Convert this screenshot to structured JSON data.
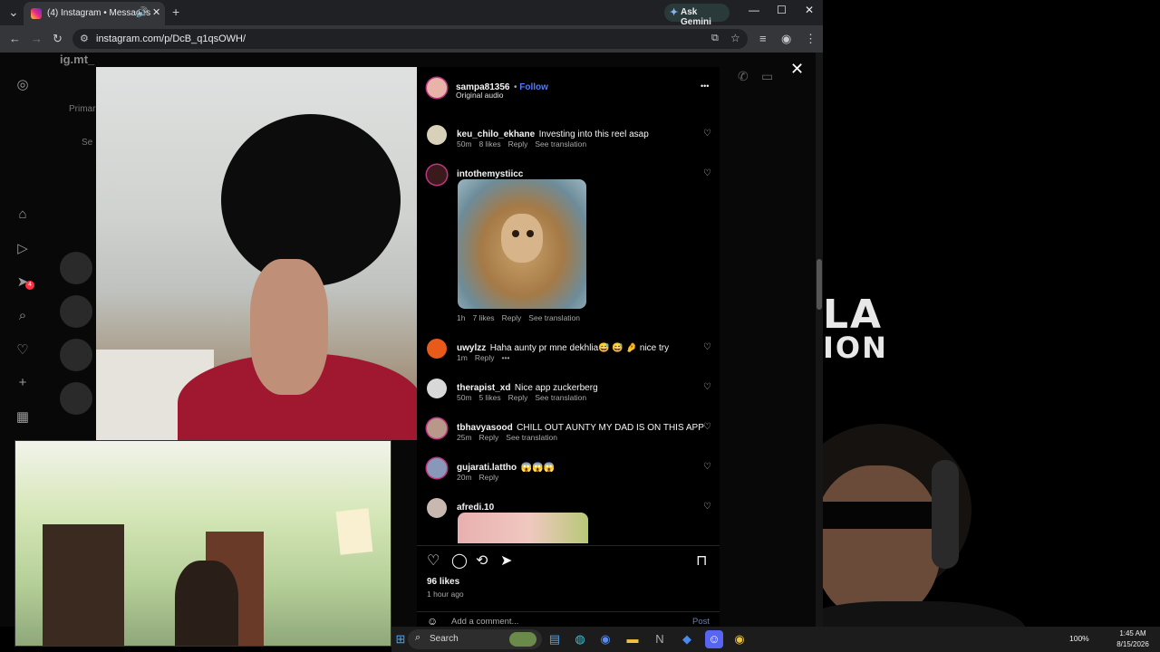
{
  "browser": {
    "tab_title": "(4) Instagram • Messages",
    "new_tab": "+",
    "gemini_label": "Ask Gemini",
    "url": "instagram.com/p/DcB_q1qsOWH/"
  },
  "instagram": {
    "username_partial": "ig.mt_",
    "tab_primary_partial": "Primar",
    "search_partial": "Se",
    "notif_badge": "4"
  },
  "post": {
    "author": "sampa81356",
    "follow_label": "Follow",
    "audio": "Original audio",
    "more": "•••",
    "likes": "96 likes",
    "time_ago": "1 hour ago",
    "add_comment_placeholder": "Add a comment...",
    "post_label": "Post"
  },
  "comments": [
    {
      "user": "keu_chilo_ekhane",
      "text": "Investing into this reel asap",
      "time": "50m",
      "likes": "8 likes",
      "reply": "Reply",
      "translate": "See translation"
    },
    {
      "user": "intothemystiicc",
      "text": "",
      "time": "1h",
      "likes": "7 likes",
      "reply": "Reply",
      "translate": "See translation",
      "has_gif": true
    },
    {
      "user": "uwylzz",
      "text": "Haha aunty pr mne dekhlia😅 😅 🤌 nice try",
      "time": "1m",
      "likes": "",
      "reply": "Reply",
      "translate": "•••"
    },
    {
      "user": "therapist_xd",
      "text": "Nice app zuckerberg",
      "time": "50m",
      "likes": "5 likes",
      "reply": "Reply",
      "translate": "See translation"
    },
    {
      "user": "tbhavyasood",
      "text": "CHILL OUT AUNTY MY DAD IS ON THIS APP",
      "time": "25m",
      "likes": "",
      "reply": "Reply",
      "translate": "See translation"
    },
    {
      "user": "gujarati.lattho",
      "text": "😱😱😱",
      "time": "20m",
      "likes": "",
      "reply": "Reply",
      "translate": ""
    },
    {
      "user": "afredi.10",
      "text": "",
      "time": "",
      "likes": "",
      "reply": "",
      "translate": "",
      "has_gif": true
    }
  ],
  "stream": {
    "logo_line1": "LA",
    "logo_line2": "ION"
  },
  "taskbar": {
    "search_label": "Search",
    "battery": "100%",
    "time": "1:45 AM",
    "date": "8/15/2026"
  },
  "colors": {
    "follow_blue": "#4f7cf7",
    "panel_bg": "#000000",
    "chrome_bg": "#202124"
  }
}
